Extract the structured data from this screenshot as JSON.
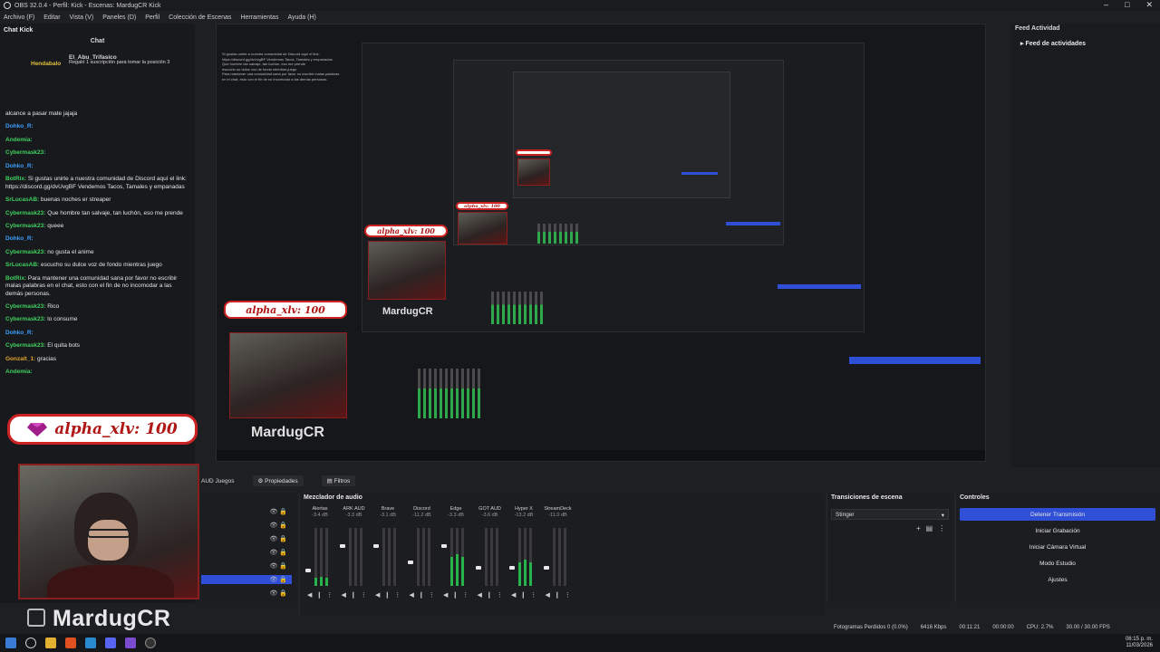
{
  "window": {
    "title": "OBS 32.0.4 - Perfil: Kick - Escenas: MardugCR Kick"
  },
  "menu": [
    "Archivo (F)",
    "Editar",
    "Vista (V)",
    "Paneles (D)",
    "Perfil",
    "Colección de Escenas",
    "Herramientas",
    "Ayuda (H)"
  ],
  "chat_dock": {
    "dock_title": "Chat Kick",
    "panel_title": "Chat",
    "pinned_user": "El_Abu_Trifasico",
    "pinned_by": "Hendabalo",
    "pinned_text": "Regaló 1 suscripción para tomar la posición 3",
    "messages": [
      {
        "user": "",
        "text": "alcance a pasar mate jajaja",
        "color": "#e6e6e6"
      },
      {
        "user": "Dohko_R:",
        "text": "",
        "color": "#3aa0ff"
      },
      {
        "user": "Andemia:",
        "text": "",
        "color": "#40d060"
      },
      {
        "user": "Cybermask23:",
        "text": "",
        "color": "#40d060"
      },
      {
        "user": "Dohko_R:",
        "text": "",
        "color": "#3aa0ff"
      },
      {
        "user": "BotRix:",
        "text": "Si gustas unirte a nuestra comunidad de Discord aquí el link: https://discord.gg/dvUvgBF Vendemos Tacos, Tamales y empanadas",
        "color": "#40d060"
      },
      {
        "user": "SrLucasAB:",
        "text": "buenas noches er streaper",
        "color": "#40d060"
      },
      {
        "user": "Cybermask23:",
        "text": "Que hombre tan salvaje, tan luchón, eso me prende",
        "color": "#40d060"
      },
      {
        "user": "Cybermask23:",
        "text": "queee",
        "color": "#40d060"
      },
      {
        "user": "Dohko_R:",
        "text": "",
        "color": "#3aa0ff"
      },
      {
        "user": "Cybermask23:",
        "text": "no gusta el anime",
        "color": "#40d060"
      },
      {
        "user": "SrLucasAB:",
        "text": "escucho su dulce voz de fondo mientras juego",
        "color": "#40d060"
      },
      {
        "user": "BotRix:",
        "text": "Para mantener una comunidad sana por favor no escribir malas palabras en el chat, esto con el fin de no incomodar a las demás personas.",
        "color": "#40d060"
      },
      {
        "user": "Cybermask23:",
        "text": "Rico",
        "color": "#40d060"
      },
      {
        "user": "Cybermask23:",
        "text": "lo consume",
        "color": "#40d060"
      },
      {
        "user": "Dohko_R:",
        "text": "",
        "color": "#3aa0ff"
      },
      {
        "user": "Cybermask23:",
        "text": "El quita bots",
        "color": "#40d060"
      },
      {
        "user": "Gonzalt_1:",
        "text": "gracias",
        "color": "#e0a030"
      },
      {
        "user": "Andemia:",
        "text": "",
        "color": "#40d060"
      }
    ]
  },
  "overlay": {
    "alert_text": "alpha_xlv: 100",
    "streamer_name": "MardugCR"
  },
  "feed_dock": {
    "dock_title": "Feed Actividad",
    "item": "Feed de actividades"
  },
  "scene_toolbar": {
    "source_name": "AUD Juegos",
    "properties": "Propiedades",
    "filters": "Filtros"
  },
  "mixer": {
    "title": "Mezclador de audio",
    "channels": [
      {
        "name": "Alertas",
        "db": "-3.4 dB",
        "level": 0.15,
        "fader": 0.25
      },
      {
        "name": "ARK AUD",
        "db": "-3.3 dB",
        "level": 0.0,
        "fader": 0.7
      },
      {
        "name": "Brave",
        "db": "-3.1 dB",
        "level": 0.0,
        "fader": 0.7
      },
      {
        "name": "Discord",
        "db": "-11.2 dB",
        "level": 0.0,
        "fader": 0.4
      },
      {
        "name": "Edge",
        "db": "-3.3 dB",
        "level": 0.55,
        "fader": 0.7
      },
      {
        "name": "GOT AUD",
        "db": "-3.6 dB",
        "level": 0.0,
        "fader": 0.3
      },
      {
        "name": "Hyper X",
        "db": "-13.2 dB",
        "level": 0.45,
        "fader": 0.3
      },
      {
        "name": "StreamDeck",
        "db": "-11.0 dB",
        "level": 0.0,
        "fader": 0.3
      }
    ]
  },
  "transitions": {
    "title": "Transiciones de escena",
    "selected": "Stinger"
  },
  "controls": {
    "title": "Controles",
    "buttons": [
      "Detener Transmisión",
      "Iniciar Grabación",
      "Iniciar Cámara Virtual",
      "Modo Estudio",
      "Ajustes"
    ]
  },
  "status": {
    "dropped": "Fotogramas Perdidos 0 (0.0%)",
    "bitrate": "6416 Kbps",
    "stream_time": "00:11:21",
    "rec_time": "00:00:00",
    "cpu": "CPU: 2.7%",
    "fps": "30.00 / 30.00 FPS"
  },
  "taskbar": {
    "time": "06:15 p. m.",
    "date": "11/03/2026"
  },
  "colors": {
    "accent": "#2f4fd6",
    "alert_red": "#b01818",
    "meter_green": "#27b24a"
  }
}
